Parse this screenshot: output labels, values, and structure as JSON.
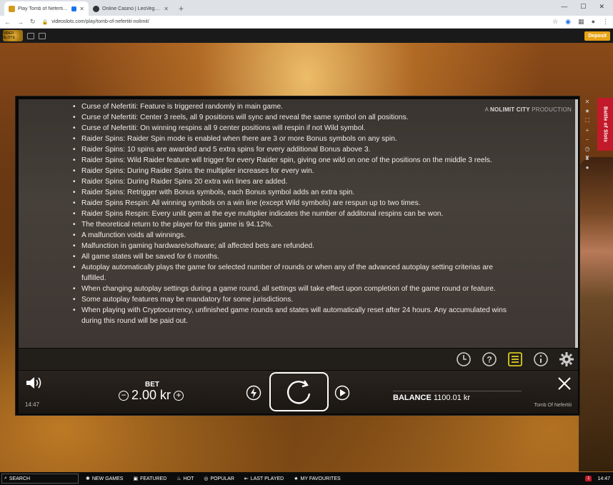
{
  "browser": {
    "tabs": [
      {
        "label": "Play Tomb of Nefertiti Video",
        "active": true
      },
      {
        "label": "Online Casino | LeoVegas™",
        "active": false
      }
    ],
    "new_tab": "+",
    "url": "videoslots.com/play/tomb-of-nefertiti-nolimit/"
  },
  "site": {
    "logo_text": "VIDEO SLOTS",
    "deposit_label": "Deposit"
  },
  "side_tab": "Battle of Slots",
  "game": {
    "producer_prefix": "A",
    "producer_name": "NOLIMIT CITY",
    "producer_suffix": "PRODUCTION",
    "rules": [
      "Curse of Nefertiti: Feature is triggered randomly in main game.",
      "Curse of Nefertiti: Center 3 reels, all 9 positions will sync and reveal the same symbol on all positions.",
      "Curse of Nefertiti: On winning respins all 9 center positions will respin if not Wild symbol.",
      "Raider Spins: Raider Spin mode is enabled when there are 3 or more Bonus symbols on any spin.",
      "Raider Spins: 10 spins are awarded and 5 extra spins for every additional Bonus above 3.",
      "Raider Spins: Wild Raider feature will trigger for every Raider spin, giving one wild on one of the positions on the middle 3 reels.",
      "Raider Spins: During Raider Spins the multiplier increases for every win.",
      "Raider Spins: During Raider Spins 20 extra win lines are added.",
      "Raider Spins: Retrigger with Bonus symbols, each Bonus symbol adds an extra spin.",
      "Raider Spins Respin: All winning symbols on a win line (except Wild symbols) are respun up to two times.",
      "Raider Spins Respin: Every unlit gem at the eye multiplier indicates the number of additonal respins can be won.",
      "The theoretical return to the player for this game is 94.12%.",
      "A malfunction voids all winnings.",
      "Malfunction in gaming hardware/software; all affected bets are refunded.",
      "All game states will be saved for 6 months.",
      "Autoplay automatically plays the game for selected number of rounds or when any of the advanced autoplay setting criterias are fulfilled.",
      "When changing autoplay settings during a game round, all settings will take effect upon completion of the game round or feature.",
      "Some autoplay features may be mandatory for some jurisdictions.",
      "When playing with Cryptocurrency, unfinished game rounds and states will automatically reset after 24 hours. Any accumulated wins during this round will be paid out."
    ],
    "bet_label": "BET",
    "bet_value": "2.00 kr",
    "balance_label": "BALANCE",
    "balance_value": "1100.01 kr",
    "time": "14:47",
    "title": "Tomb Of Nefertiti"
  },
  "bottom": {
    "search_label": "SEARCH",
    "nav": [
      "NEW GAMES",
      "FEATURED",
      "HOT",
      "POPULAR",
      "LAST PLAYED",
      "MY FAVOURITES"
    ],
    "notification_count": "1",
    "clock": "14:47"
  },
  "colors": {
    "accent": "#e8a317",
    "side_tab": "#c21a2a",
    "highlight_icon": "#f0e020"
  }
}
